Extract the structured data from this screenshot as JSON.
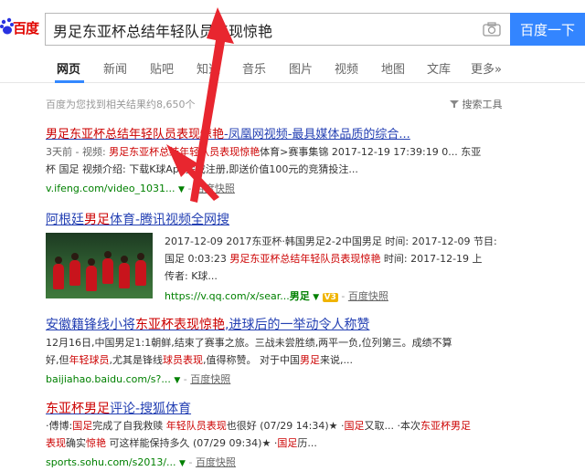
{
  "logo": {
    "text_paw": "Bai",
    "text_du": "百度",
    "alt": "百度"
  },
  "search": {
    "query": "男足东亚杯总结年轻队员表现惊艳",
    "button": "百度一下"
  },
  "tabs": [
    {
      "label": "网页",
      "active": true
    },
    {
      "label": "新闻"
    },
    {
      "label": "贴吧"
    },
    {
      "label": "知道"
    },
    {
      "label": "音乐"
    },
    {
      "label": "图片"
    },
    {
      "label": "视频"
    },
    {
      "label": "地图"
    },
    {
      "label": "文库"
    },
    {
      "label": "更多»"
    }
  ],
  "stats": "百度为您找到相关结果约8,650个",
  "tools": "搜索工具",
  "results": [
    {
      "title_a": "男足东亚杯总结年轻队员表现惊艳",
      "title_b": "-凤凰网视频-最具媒体品质的综合...",
      "line1_a": "3天前 - 视频: ",
      "line1_b": "男足东亚杯总结年轻队员表现惊艳",
      "line1_c": "体育>赛事集锦 2017-12-19 17:39:19 0... 东亚",
      "line2": "杯 国足 视频介绍: 下载K球App完成注册,即送价值100元的竞猜投注...",
      "url": "v.ifeng.com/video_1031...",
      "snap": "百度快照"
    },
    {
      "title_a": "阿根廷",
      "title_b": "男足",
      "title_c": "体育-腾讯视频全网搜",
      "line1": "2017-12-09 2017东亚杯·韩国男足2-2中国男足 时间: 2017-12-09 节目:",
      "line2_a": "国足 0:03:23 ",
      "line2_b": "男足东亚杯总结年轻队员表现惊艳",
      "line2_c": " 时间: 2017-12-19 上",
      "line3": "传者: K球...",
      "url": "https://v.qq.com/x/sear...",
      "url_bold": "男足",
      "badge": "V3",
      "snap": "百度快照"
    },
    {
      "title_a": "安徽籍锋线小将",
      "title_b": "东亚杯表现惊艳",
      "title_c": ",进球后的一举动令人称赞",
      "line1": "12月16日,中国男足1:1朝鲜,结束了赛事之旅。三战未尝胜绩,两平一负,位列第三。成绩不算",
      "line2_a": "好,但",
      "line2_b": "年轻球员",
      "line2_c": ",尤其是锋线",
      "line2_d": "球员表现",
      "line2_e": ",值得称赞。 对于中国",
      "line2_f": "男足",
      "line2_g": "来说,...",
      "url": "baijiahao.baidu.com/s?...",
      "snap": "百度快照"
    },
    {
      "title_a": "东亚杯",
      "title_b": "男足",
      "title_c": "评论-搜狐体育",
      "line1_a": "·傅博:",
      "line1_b": "国足",
      "line1_c": "完成了自我救赎 ",
      "line1_d": "年轻队员表现",
      "line1_e": "也很好 (07/29 14:34)★ ·",
      "line1_f": "国足",
      "line1_g": "又取... ·本次",
      "line1_h": "东亚杯男足",
      "line2_a": "表现",
      "line2_b": "确实",
      "line2_c": "惊艳",
      "line2_d": " 可这样能保持多久 (07/29 09:34)★ ·",
      "line2_e": "国足",
      "line2_f": "历...",
      "url": "sports.sohu.com/s2013/...",
      "snap": "百度快照"
    }
  ],
  "colors": {
    "link": "#2440b3",
    "highlight": "#c00",
    "url": "#008000",
    "button": "#3385ff",
    "arrow": "#e8262f"
  },
  "icons": [
    "camera-icon",
    "filter-icon",
    "arrow-annotation"
  ]
}
